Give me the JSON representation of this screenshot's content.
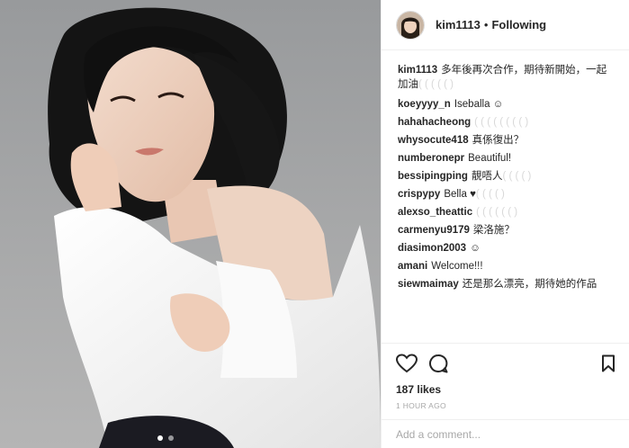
{
  "header": {
    "username": "kim1113",
    "separator": "•",
    "follow_status": "Following"
  },
  "comments": [
    {
      "user": "kim1113",
      "text": "多年後再次合作，期待新開始，一起",
      "faint": "",
      "text2": "加油",
      "faint2": "( ( ( ( ( )"
    },
    {
      "user": "koeyyyy_n",
      "text": "Iseballa ☺",
      "faint": ""
    },
    {
      "user": "hahahacheong",
      "text": "",
      "faint": "( ( ( ( ( ( ( ( )"
    },
    {
      "user": "whysocute418",
      "text": "真係復出？",
      "faint": ""
    },
    {
      "user": "numberonepr",
      "text": "Beautiful!",
      "faint": ""
    },
    {
      "user": "bessipingping",
      "text": "靚唔人",
      "faint": "( ( ( ( )"
    },
    {
      "user": "crispypy",
      "text": "Bella ♥",
      "faint": "( ( ( ( )"
    },
    {
      "user": "alexso_theattic",
      "text": "",
      "faint": "( ( ( ( ( ( )"
    },
    {
      "user": "carmenyu9179",
      "text": "梁洛施？",
      "faint": ""
    },
    {
      "user": "diasimon2003",
      "text": "☺",
      "faint": ""
    },
    {
      "user": "amani",
      "text": "Welcome!!!",
      "faint": ""
    },
    {
      "user": "siewmaimay",
      "text": "还是那么漂亮，期待她的作品",
      "faint": ""
    }
  ],
  "actions": {
    "like_icon": "heart-icon",
    "comment_icon": "comment-icon",
    "save_icon": "bookmark-icon"
  },
  "likes": "187 likes",
  "time": "1 HOUR AGO",
  "add_comment": {
    "placeholder": "Add a comment..."
  },
  "colors": {
    "text": "#262626",
    "muted": "#a8a8a8",
    "border": "#efefef",
    "photo_bg": "#a3a4a6"
  }
}
